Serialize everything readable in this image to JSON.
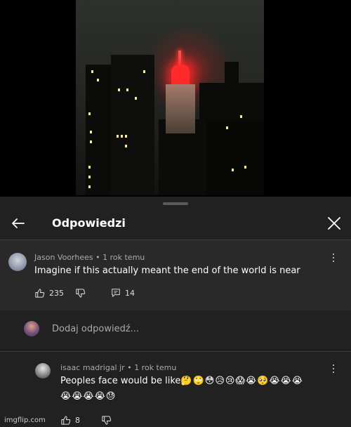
{
  "panel": {
    "title": "Odpowiedzi"
  },
  "parent_comment": {
    "author": "Jason Voorhees",
    "time": "1 rok temu",
    "text": "Imagine if this actually meant the end of the world is near",
    "likes": "235",
    "replies": "14"
  },
  "reply_input": {
    "placeholder": "Dodaj odpowiedź..."
  },
  "reply_comment": {
    "author": "isaac madrigal jr",
    "time": "1 rok temu",
    "text": "Peoples face would be like",
    "emojis_line1": "🤔🙄😳😥😢😱😭🥺😭😭😭",
    "emojis_line2": "😭😭😭😭😓",
    "likes": "8"
  },
  "watermark": "imgflip.com",
  "colors": {
    "panel_bg": "#212121",
    "highlight_bg": "#292929",
    "red_light": "#ff2a2a"
  }
}
